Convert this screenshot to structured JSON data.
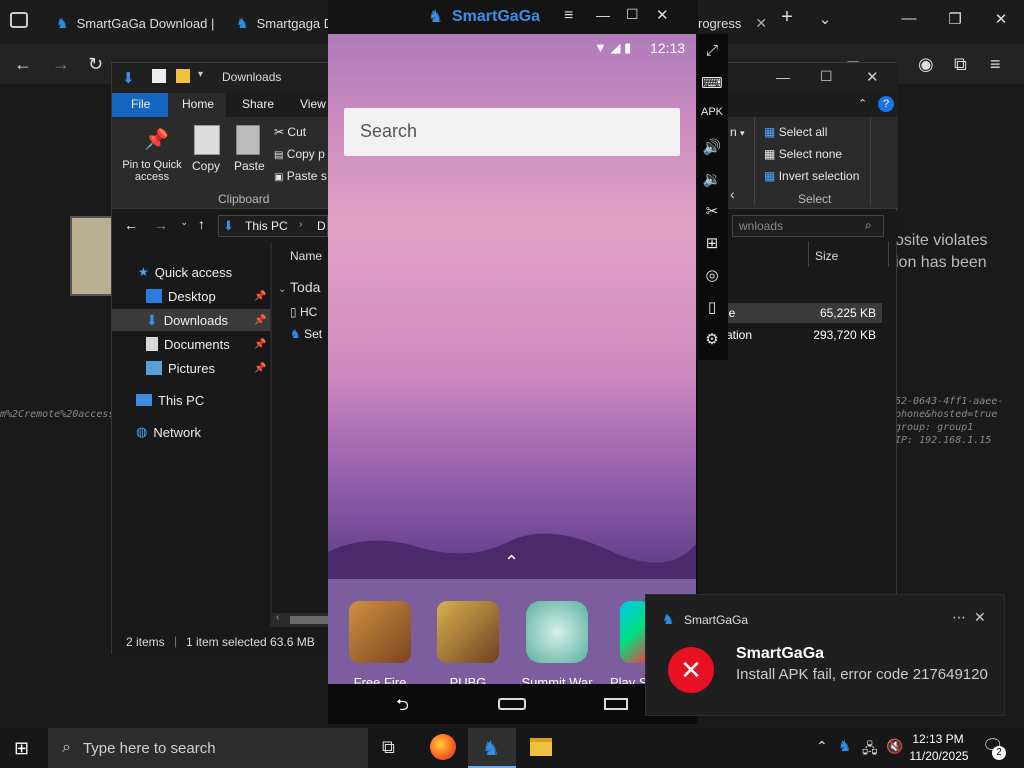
{
  "browser": {
    "tabs": [
      {
        "label": "SmartGaGa Download |"
      },
      {
        "label": "Smartgaga Dr"
      },
      {
        "label": "rogress"
      }
    ]
  },
  "bg_texts": {
    "policy_line1": "osite violates",
    "policy_line2": "ion has been",
    "left_code": "m%2Cremote%20access",
    "right_line1": "52-0643-4ff1-aaee-",
    "right_line2": "phone&hosted=true",
    "right_line3": "group: group1",
    "right_line4": "IP: 192.168.1.15"
  },
  "explorer": {
    "title": "Downloads",
    "ribbon_tabs": [
      "File",
      "Home",
      "Share",
      "View"
    ],
    "pin_label": "Pin to Quick access",
    "copy_label": "Copy",
    "paste_label": "Paste",
    "cut_label": "Cut",
    "copy_path_label": "Copy p",
    "paste_shortcut_label": "Paste s",
    "clipboard_group": "Clipboard",
    "select_all": "Select all",
    "select_none": "Select none",
    "invert_selection": "Invert selection",
    "select_group": "Select",
    "open_label": "n",
    "address": [
      "This PC",
      "D"
    ],
    "search_placeholder": "wnloads",
    "columns": {
      "name": "Name",
      "size": "Size"
    },
    "group_today": "Toda",
    "files": [
      {
        "name": "HC",
        "type_tail": "le",
        "size": "65,225 KB"
      },
      {
        "name": "Set",
        "type_tail": "ation",
        "size": "293,720 KB"
      }
    ],
    "nav": [
      {
        "label": "Quick access"
      },
      {
        "label": "Desktop"
      },
      {
        "label": "Downloads"
      },
      {
        "label": "Documents"
      },
      {
        "label": "Pictures"
      },
      {
        "label": "This PC"
      },
      {
        "label": "Network"
      }
    ],
    "status": {
      "items": "2 items",
      "selected": "1 item selected  63.6 MB"
    }
  },
  "emulator": {
    "title": "SmartGaGa",
    "time": "12:13",
    "search_placeholder": "Search",
    "apps": [
      {
        "label": "Free Fire"
      },
      {
        "label": "PUBG MOBI.."
      },
      {
        "label": "Summit War"
      },
      {
        "label": "Play S"
      }
    ]
  },
  "toast": {
    "app_name": "SmartGaGa",
    "title": "SmartGaGa",
    "message": "Install APK  fail, error code 217649120"
  },
  "taskbar": {
    "search_placeholder": "Type here to search",
    "time": "12:13 PM",
    "date": "11/20/2025",
    "notification_count": "2"
  },
  "colors": {
    "accent": "#0078d4",
    "smartgaga_blue": "#2f8fe8",
    "error_red": "#e81123"
  }
}
